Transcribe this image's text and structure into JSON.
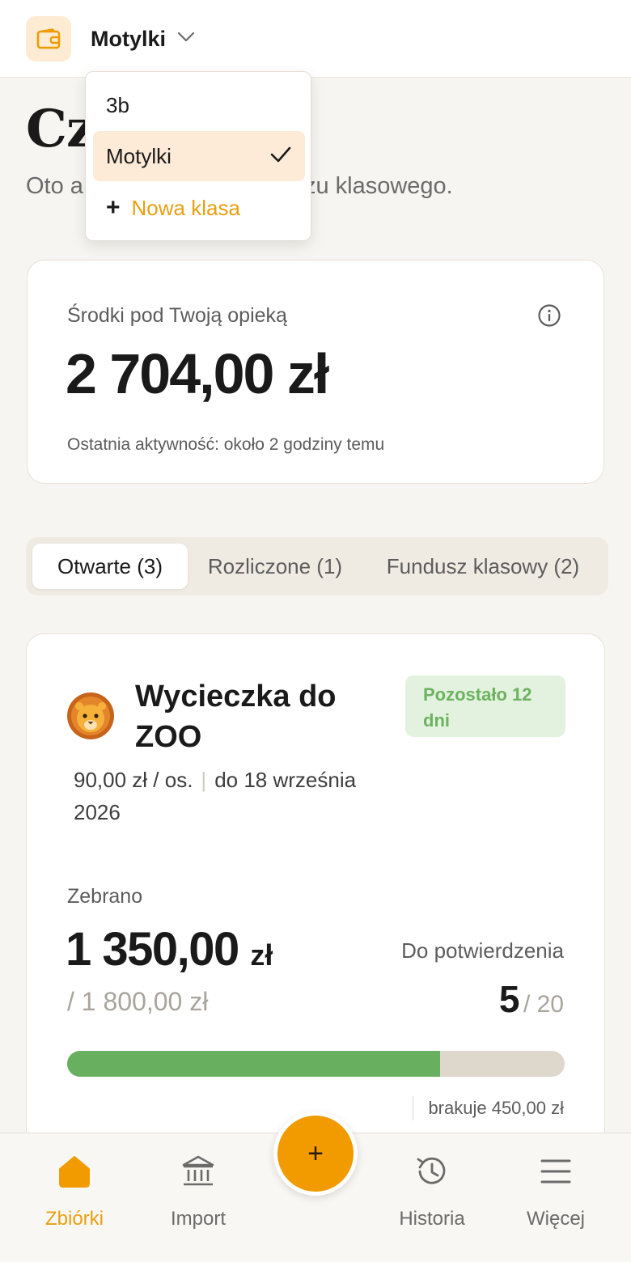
{
  "header": {
    "class_name": "Motylki",
    "icons": {
      "app": "wallet-icon",
      "dropdown": "chevron-down-icon"
    }
  },
  "dropdown": {
    "items": [
      {
        "label": "3b",
        "selected": false
      },
      {
        "label": "Motylki",
        "selected": true
      }
    ],
    "new_class_label": "Nowa klasa"
  },
  "page": {
    "title": "Cz",
    "subtitle_visible_left": "Oto a",
    "subtitle_visible_right": "zu klasowego."
  },
  "balance": {
    "label": "Środki pod Twoją opieką",
    "amount": "2 704,00 zł",
    "last_activity": "Ostatnia aktywność: około 2 godziny temu"
  },
  "tabs": [
    {
      "label": "Otwarte (3)",
      "active": true
    },
    {
      "label": "Rozliczone (1)",
      "active": false
    },
    {
      "label": "Fundusz klasowy (2)",
      "active": false
    }
  ],
  "collection": {
    "emoji": "🦁",
    "title": "Wycieczka do ZOO",
    "days_left": "Pozostało 12 dni",
    "per_person": "90,00 zł / os.",
    "deadline": "do 18 września 2026",
    "collected_label": "Zebrano",
    "collected_amount": "1 350,00",
    "currency": "zł",
    "target": "/ 1 800,00 zł",
    "confirm_label": "Do potwierdzenia",
    "confirm_count": "5",
    "confirm_total": "/ 20",
    "progress_fraction": 0.75,
    "missing": "brakuje 450,00 zł"
  },
  "bottom_nav": {
    "items": [
      {
        "label": "Zbiórki",
        "icon": "home-icon",
        "active": true
      },
      {
        "label": "Import",
        "icon": "bank-icon",
        "active": false
      },
      {
        "label": "Historia",
        "icon": "history-icon",
        "active": false
      },
      {
        "label": "Więcej",
        "icon": "menu-icon",
        "active": false
      }
    ],
    "fab_label": "+"
  },
  "colors": {
    "accent": "#f29b00",
    "accent_text": "#e8a012",
    "progress": "#68b060",
    "badge_bg": "#e3f2df",
    "badge_text": "#6cb35f",
    "selected_bg": "#fdebd8"
  }
}
